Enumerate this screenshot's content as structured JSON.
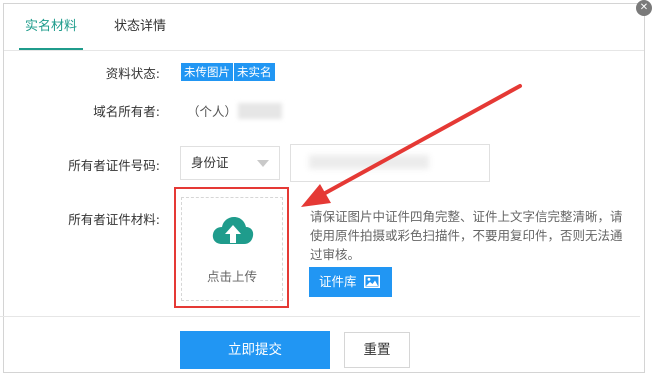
{
  "tabs": [
    {
      "label": "实名材料",
      "active": true
    },
    {
      "label": "状态详情",
      "active": false
    }
  ],
  "fields": {
    "status_label": "资料状态:",
    "status_badges": [
      "未传图片",
      "未实名"
    ],
    "owner_label": "域名所有者:",
    "owner_value": "（个人）",
    "id_label": "所有者证件号码:",
    "id_type_selected": "身份证",
    "id_number_value": "",
    "material_label": "所有者证件材料:"
  },
  "upload": {
    "text": "点击上传",
    "icon": "cloud-upload-icon"
  },
  "tip_text": "请保证图片中证件四角完整、证件上文字信完整清晰，请使用原件拍摄或彩色扫描件，不要用复印件，否则无法通过审核。",
  "library_button": "证件库",
  "buttons": {
    "submit": "立即提交",
    "reset": "重置"
  },
  "colors": {
    "accent": "#1f9c8c",
    "primary": "#2196f3",
    "highlight": "#e53935"
  }
}
